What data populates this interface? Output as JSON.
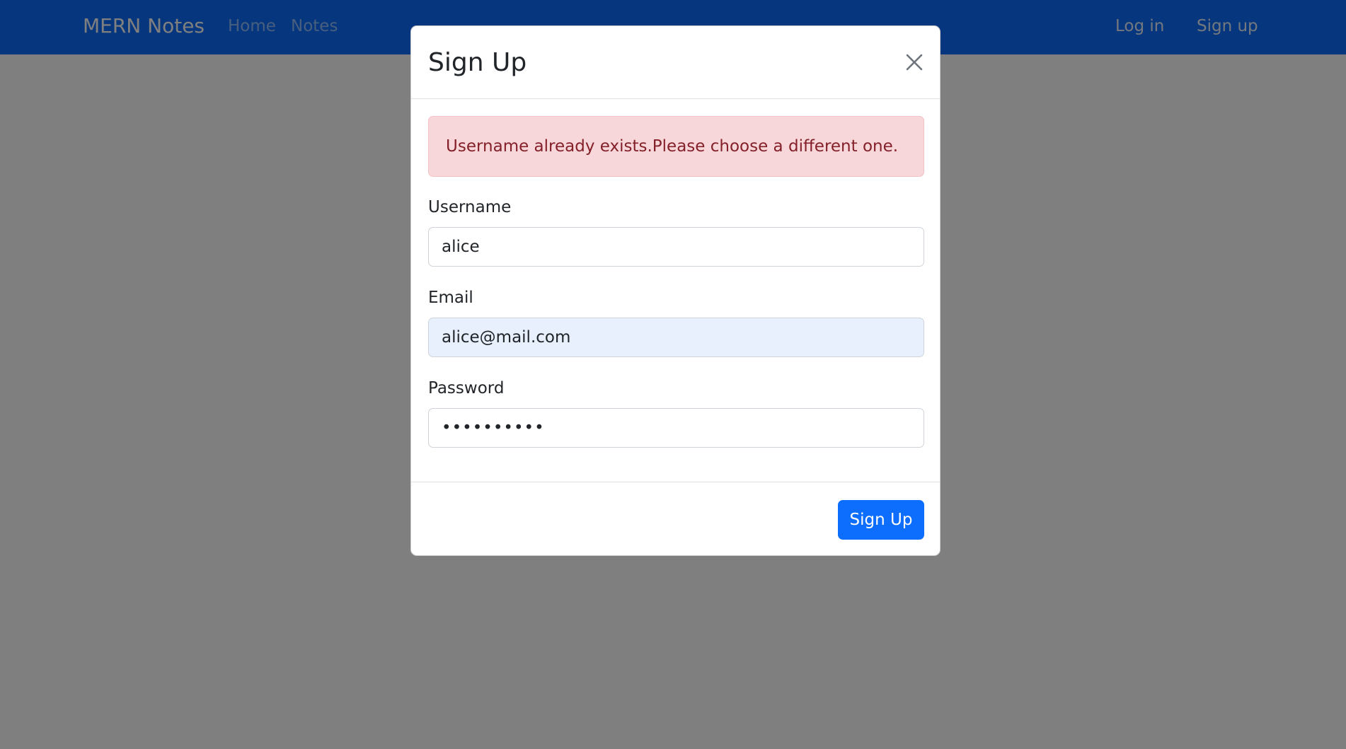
{
  "navbar": {
    "brand": "MERN Notes",
    "links": [
      "Home",
      "Notes"
    ],
    "right_links": [
      "Log in",
      "Sign up"
    ]
  },
  "modal": {
    "title": "Sign Up",
    "alert": "Username already exists.Please choose a different one.",
    "fields": {
      "username": {
        "label": "Username",
        "value": "alice"
      },
      "email": {
        "label": "Email",
        "value": "alice@mail.com"
      },
      "password": {
        "label": "Password",
        "value": "••••••••••"
      }
    },
    "submit_label": "Sign Up"
  },
  "colors": {
    "navbar": "#0d6efd",
    "alert_bg": "#f8d7da",
    "alert_text": "#842029",
    "primary_button": "#0d6efd",
    "autofill_bg": "#e8f0fe"
  }
}
